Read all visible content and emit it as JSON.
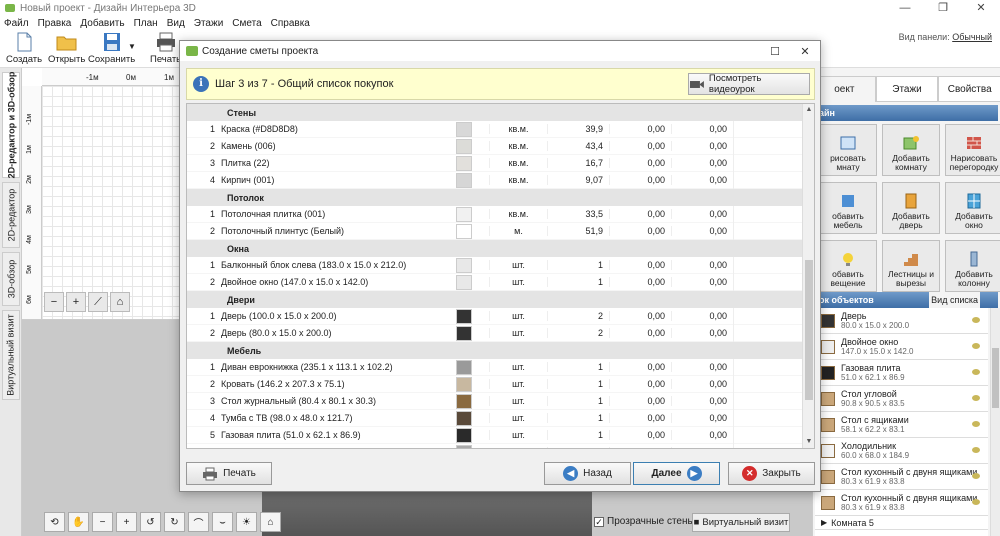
{
  "window": {
    "title": "Новый проект - Дизайн Интерьера 3D",
    "controls": [
      "—",
      "❐",
      "✕"
    ]
  },
  "menu": [
    "Файл",
    "Правка",
    "Добавить",
    "План",
    "Вид",
    "Этажи",
    "Смета",
    "Справка"
  ],
  "toolbar": {
    "create": "Создать",
    "open": "Открыть",
    "save": "Сохранить",
    "print": "Печать",
    "panel_view_label": "Вид панели:",
    "panel_view_value": "Обычный"
  },
  "left_tabs": [
    "2D-редактор и 3D-обзор",
    "2D-редактор",
    "3D-обзор",
    "Виртуальный визит"
  ],
  "ruler": {
    "top": [
      "-1м",
      "0м",
      "1м"
    ],
    "left": [
      "-1м",
      "1м",
      "2м",
      "3м",
      "4м",
      "5м",
      "6м"
    ]
  },
  "bottom_bar": {
    "transparent_walls": "Прозрачные стены",
    "virtual_visit": "Виртуальный визит"
  },
  "right_panel": {
    "tabs": [
      "оект",
      "Этажи",
      "Свойства"
    ],
    "section_title": "айн",
    "tiles": [
      "рисовать\nмнату",
      "Добавить\nкомнату",
      "Нарисовать\nперегородку",
      "обавить\nмебель",
      "Добавить\nдверь",
      "Добавить\nокно",
      "обавить\nвещение",
      "Лестницы и\nвырезы",
      "Добавить\nколонну"
    ],
    "objects_title": "ок объектов",
    "objects_view": "Вид списка",
    "objects": [
      {
        "name": "Дверь",
        "size": "80.0 x 15.0 x 200.0"
      },
      {
        "name": "Двойное окно",
        "size": "147.0 x 15.0 x 142.0"
      },
      {
        "name": "Газовая плита",
        "size": "51.0 x 62.1 x 86.9"
      },
      {
        "name": "Стол угловой",
        "size": "90.8 x 90.5 x 83.5"
      },
      {
        "name": "Стол с ящиками",
        "size": "58.1 x 62.2 x 83.1"
      },
      {
        "name": "Холодильник",
        "size": "60.0 x 68.0 x 184.9"
      },
      {
        "name": "Стол кухонный с двуня ящиками",
        "size": "80.3 x 61.9 x 83.8"
      },
      {
        "name": "Стол кухонный с двуня ящиками",
        "size": "80.3 x 61.9 x 83.8"
      },
      {
        "name": "Комната 5",
        "size": ""
      }
    ]
  },
  "dialog": {
    "title": "Создание сметы проекта",
    "step": "Шаг 3 из 7 - Общий список покупок",
    "video_button": "Посмотреть видеоурок",
    "print_button": "Печать",
    "back_button": "Назад",
    "next_button": "Далее",
    "close_button": "Закрыть",
    "rows": [
      {
        "type": "cat",
        "name": "Стены"
      },
      {
        "type": "item",
        "num": "1",
        "name": "Краска (#D8D8D8)",
        "unit": "кв.м.",
        "qty": "39,9",
        "p1": "0,00",
        "p2": "0,00",
        "color": "#d8d8d8"
      },
      {
        "type": "item",
        "num": "2",
        "name": "Камень (006)",
        "unit": "кв.м.",
        "qty": "43,4",
        "p1": "0,00",
        "p2": "0,00",
        "color": "#dcdcd8"
      },
      {
        "type": "item",
        "num": "3",
        "name": "Плитка (22)",
        "unit": "кв.м.",
        "qty": "16,7",
        "p1": "0,00",
        "p2": "0,00",
        "color": "#e2e0dc"
      },
      {
        "type": "item",
        "num": "4",
        "name": "Кирпич (001)",
        "unit": "кв.м.",
        "qty": "9,07",
        "p1": "0,00",
        "p2": "0,00",
        "color": "#d6d6d6"
      },
      {
        "type": "cat",
        "name": "Потолок"
      },
      {
        "type": "item",
        "num": "1",
        "name": "Потолочная плитка (001)",
        "unit": "кв.м.",
        "qty": "33,5",
        "p1": "0,00",
        "p2": "0,00",
        "color": "#f1f1f1"
      },
      {
        "type": "item",
        "num": "2",
        "name": "Потолочный плинтус (Белый)",
        "unit": "м.",
        "qty": "51,9",
        "p1": "0,00",
        "p2": "0,00",
        "color": "#ffffff"
      },
      {
        "type": "cat",
        "name": "Окна"
      },
      {
        "type": "item",
        "num": "1",
        "name": "Балконный блок слева (183.0 x 15.0 x 212.0)",
        "unit": "шт.",
        "qty": "1",
        "p1": "0,00",
        "p2": "0,00",
        "color": "#e8e8e8"
      },
      {
        "type": "item",
        "num": "2",
        "name": "Двойное окно (147.0 x 15.0 x 142.0)",
        "unit": "шт.",
        "qty": "1",
        "p1": "0,00",
        "p2": "0,00",
        "color": "#e8e8e8"
      },
      {
        "type": "cat",
        "name": "Двери"
      },
      {
        "type": "item",
        "num": "1",
        "name": "Дверь (100.0 x 15.0 x 200.0)",
        "unit": "шт.",
        "qty": "2",
        "p1": "0,00",
        "p2": "0,00",
        "color": "#333333"
      },
      {
        "type": "item",
        "num": "2",
        "name": "Дверь (80.0 x 15.0 x 200.0)",
        "unit": "шт.",
        "qty": "2",
        "p1": "0,00",
        "p2": "0,00",
        "color": "#333333"
      },
      {
        "type": "cat",
        "name": "Мебель"
      },
      {
        "type": "item",
        "num": "1",
        "name": "Диван еврокнижка (235.1 x 113.1 x 102.2)",
        "unit": "шт.",
        "qty": "1",
        "p1": "0,00",
        "p2": "0,00",
        "color": "#9a9a9a"
      },
      {
        "type": "item",
        "num": "2",
        "name": "Кровать (146.2 x 207.3 x 75.1)",
        "unit": "шт.",
        "qty": "1",
        "p1": "0,00",
        "p2": "0,00",
        "color": "#c8b8a0"
      },
      {
        "type": "item",
        "num": "3",
        "name": "Стол журнальный (80.4 x 80.1 x 30.3)",
        "unit": "шт.",
        "qty": "1",
        "p1": "0,00",
        "p2": "0,00",
        "color": "#8a6a40"
      },
      {
        "type": "item",
        "num": "4",
        "name": "Тумба с ТВ (98.0 x 48.0 x 121.7)",
        "unit": "шт.",
        "qty": "1",
        "p1": "0,00",
        "p2": "0,00",
        "color": "#5a4a3a"
      },
      {
        "type": "item",
        "num": "5",
        "name": "Газовая плита (51.0 x 62.1 x 86.9)",
        "unit": "шт.",
        "qty": "1",
        "p1": "0,00",
        "p2": "0,00",
        "color": "#2a2a2a"
      },
      {
        "type": "item",
        "num": "6",
        "name": "",
        "unit": "",
        "qty": "1",
        "p1": "0,00",
        "p2": "0,00",
        "color": "#aaaaaa"
      }
    ]
  }
}
